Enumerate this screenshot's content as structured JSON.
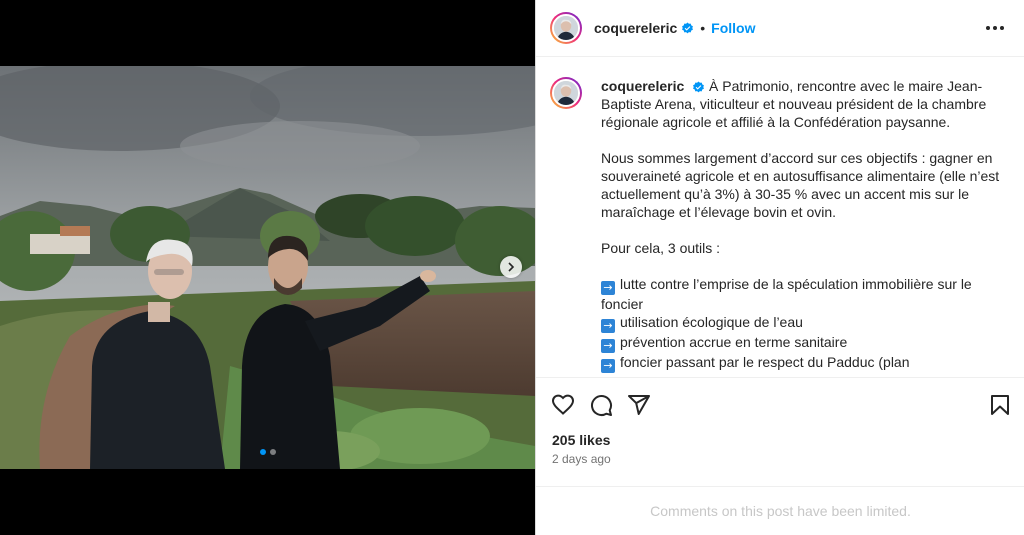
{
  "post": {
    "username": "coquereleric",
    "follow_label": "Follow",
    "separator": "•",
    "caption": {
      "intro": "À Patrimonio, rencontre avec le maire Jean-Baptiste Arena, viticulteur et nouveau président de la chambre régionale agricole et affilié à la Confédération paysanne.",
      "paragraph2": "Nous sommes largement d’accord sur ces objectifs : gagner en souveraineté agricole et en autosuffisance alimentaire (elle n’est actuellement qu’à 3%) à 30-35 % avec un accent mis sur le maraîchage et l’élevage bovin et ovin.",
      "paragraph3": "Pour cela, 3 outils :",
      "bullets": [
        "lutte contre l’emprise de la spéculation immobilière sur le foncier",
        "utilisation écologique de l’eau",
        "prévention accrue en terme sanitaire",
        "foncier passant par le respect du Padduc (plan d’aménagement et de développement durable de Corse) par les PLU (Plan Local"
      ],
      "bullet_glyph": "→"
    },
    "likes": "205 likes",
    "time": "2 days ago",
    "comments_limited": "Comments on this post have been limited.",
    "carousel": {
      "count": 2,
      "active_index": 0
    }
  },
  "icons": {
    "verified": "verified-badge-icon",
    "more": "more-options-icon",
    "like": "heart-icon",
    "comment": "comment-icon",
    "share": "share-icon",
    "save": "bookmark-icon",
    "next": "chevron-right-icon"
  },
  "colors": {
    "accent": "#0095f6",
    "text": "#262626",
    "secondary": "#737373",
    "muted": "#c7c7c7"
  }
}
